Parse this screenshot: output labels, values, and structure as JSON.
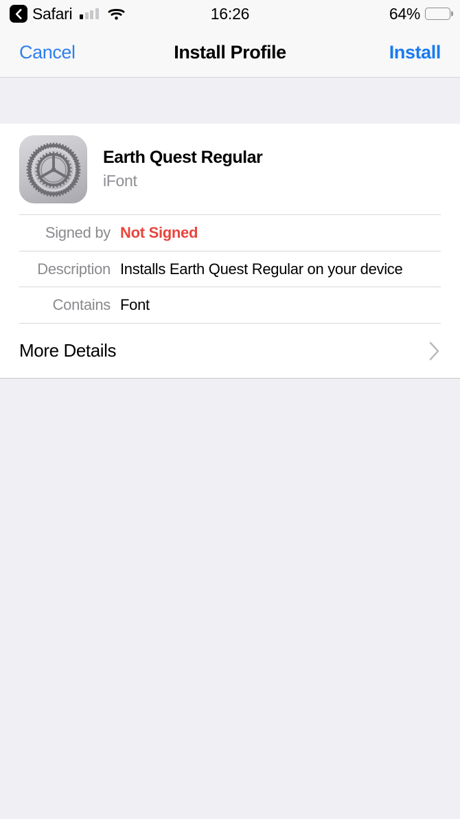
{
  "status_bar": {
    "back_label": "Safari",
    "back_icon": "chevron-left-icon",
    "signal_icon": "cellular-signal-icon",
    "signal_bars_active": 1,
    "signal_bars_total": 4,
    "wifi_icon": "wifi-icon",
    "time": "16:26",
    "battery_percent": "64%",
    "battery_level": 64,
    "battery_icon": "battery-icon"
  },
  "nav_bar": {
    "cancel_label": "Cancel",
    "title": "Install Profile",
    "install_label": "Install",
    "accent_color": "#2F7FEE"
  },
  "profile": {
    "icon_name": "settings-gear-icon",
    "name": "Earth Quest Regular",
    "organization": "iFont"
  },
  "details": [
    {
      "label": "Signed by",
      "value": "Not Signed",
      "style": "danger",
      "color": "#E8453C"
    },
    {
      "label": "Description",
      "value": "Installs Earth Quest Regular on your device",
      "style": "normal"
    },
    {
      "label": "Contains",
      "value": "Font",
      "style": "normal"
    }
  ],
  "more_details": {
    "label": "More Details",
    "chevron_icon": "chevron-right-icon"
  },
  "colors": {
    "background": "#EFEFF4",
    "card": "#FFFFFF",
    "bar": "#F8F8F8",
    "label_gray": "#8A8A8E",
    "blue": "#2F7FEE",
    "red": "#E8453C"
  }
}
